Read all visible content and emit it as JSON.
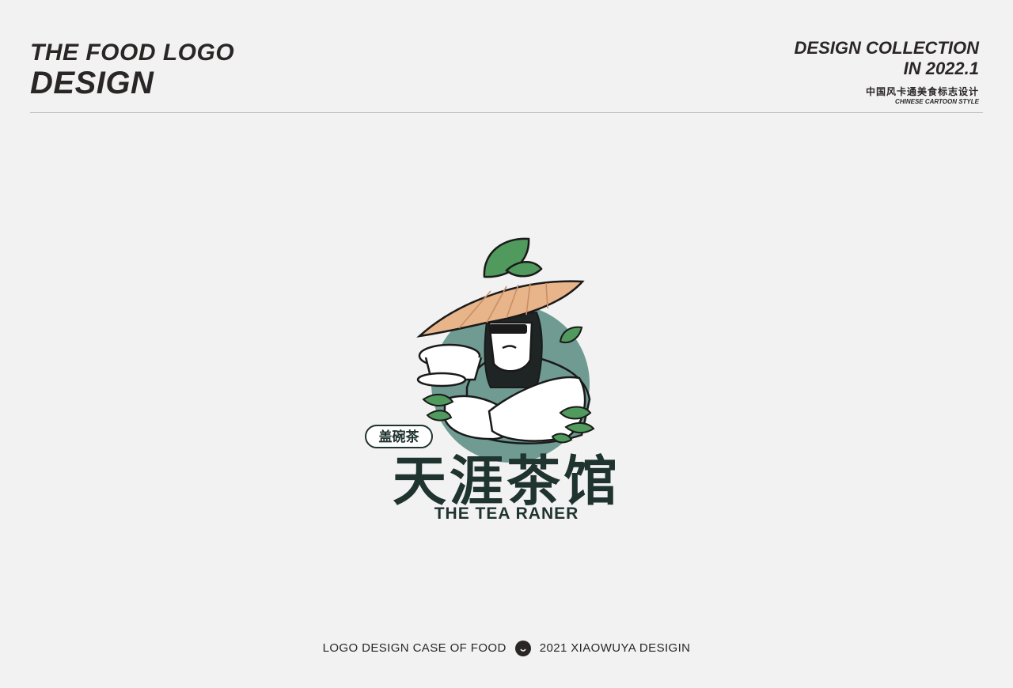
{
  "header": {
    "title_line1": "THE FOOD LOGO",
    "title_line2": "DESIGN",
    "collection_line1": "DESIGN COLLECTION",
    "collection_line2": "IN 2022.1",
    "subtitle_cn": "中国风卡通美食标志设计",
    "subtitle_en": "CHINESE CARTOON STYLE"
  },
  "logo": {
    "badge_text": "盖碗茶",
    "name_cn": "天涯茶馆",
    "name_en": "THE TEA RANER",
    "colors": {
      "dark": "#1f332f",
      "teal": "#6f9b92",
      "leaf": "#4f9a5c",
      "hat": "#e8b48a",
      "outline": "#1a1a1a"
    }
  },
  "footer": {
    "left_text": "LOGO DESIGN CASE OF FOOD",
    "right_text": "2021 XIAOWUYA DESIGIN",
    "icon": "crow-head-icon"
  }
}
